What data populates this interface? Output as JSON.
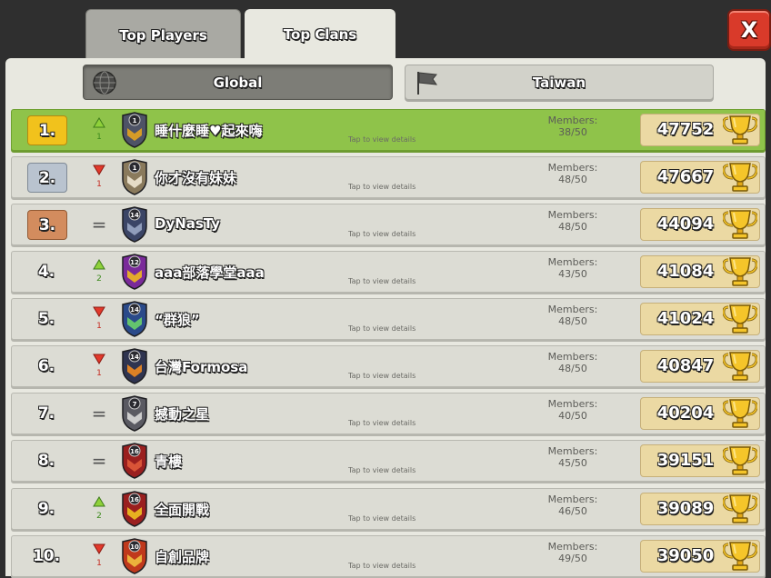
{
  "tabs": {
    "players": "Top Players",
    "clans": "Top Clans"
  },
  "close_label": "X",
  "filters": {
    "global": "Global",
    "local": "Taiwan"
  },
  "members_label": "Members:",
  "tap_hint": "Tap to view details",
  "rows": [
    {
      "rank": "1.",
      "change": "up",
      "delta": "1",
      "name": "睡什麼睡♥起來嗨",
      "members": "38/50",
      "score": "47752",
      "badge_level": "1",
      "badge_color": "#4e5366",
      "accent": "#e4a320"
    },
    {
      "rank": "2.",
      "change": "down",
      "delta": "1",
      "name": "你才沒有妹妹",
      "members": "48/50",
      "score": "47667",
      "badge_level": "1",
      "badge_color": "#8a7a5c",
      "accent": "#efe7d2"
    },
    {
      "rank": "3.",
      "change": "same",
      "delta": "=",
      "name": "DyNasTy",
      "members": "48/50",
      "score": "44094",
      "badge_level": "14",
      "badge_color": "#3b4566",
      "accent": "#9aa6c4"
    },
    {
      "rank": "4.",
      "change": "up",
      "delta": "2",
      "name": "aaa部落學堂aaa",
      "members": "43/50",
      "score": "41084",
      "badge_level": "12",
      "badge_color": "#7a2a9a",
      "accent": "#f0b820"
    },
    {
      "rank": "5.",
      "change": "down",
      "delta": "1",
      "name": "“群狼”",
      "members": "48/50",
      "score": "41024",
      "badge_level": "14",
      "badge_color": "#2a4a8a",
      "accent": "#6ad06a"
    },
    {
      "rank": "6.",
      "change": "down",
      "delta": "1",
      "name": "台灣Formosa",
      "members": "48/50",
      "score": "40847",
      "badge_level": "14",
      "badge_color": "#2f3450",
      "accent": "#f08a20"
    },
    {
      "rank": "7.",
      "change": "same",
      "delta": "=",
      "name": "撼動之星",
      "members": "40/50",
      "score": "40204",
      "badge_level": "7",
      "badge_color": "#5a5a62",
      "accent": "#d8d8d8"
    },
    {
      "rank": "8.",
      "change": "same",
      "delta": "=",
      "name": "青樓",
      "members": "45/50",
      "score": "39151",
      "badge_level": "16",
      "badge_color": "#9a1f1f",
      "accent": "#e05a3a"
    },
    {
      "rank": "9.",
      "change": "up",
      "delta": "2",
      "name": "全面開戰",
      "members": "46/50",
      "score": "39089",
      "badge_level": "16",
      "badge_color": "#9a1f1f",
      "accent": "#f0c020"
    },
    {
      "rank": "10.",
      "change": "down",
      "delta": "1",
      "name": "自創品牌",
      "members": "49/50",
      "score": "39050",
      "badge_level": "10",
      "badge_color": "#c0391c",
      "accent": "#f0c040"
    }
  ]
}
